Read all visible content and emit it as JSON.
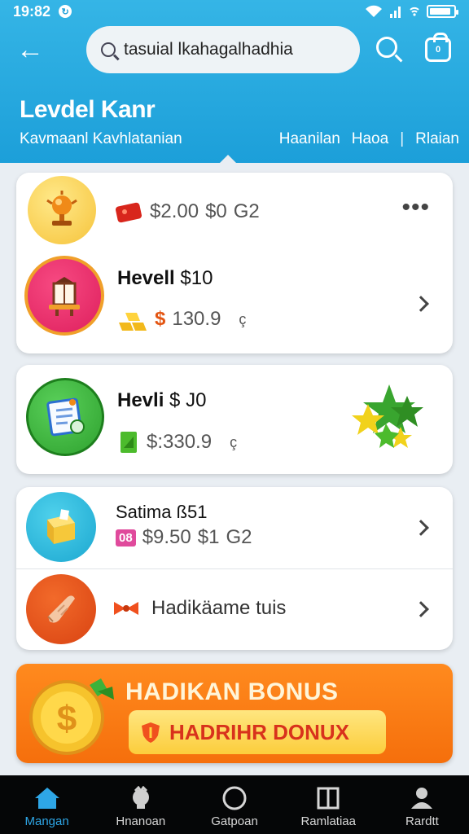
{
  "status": {
    "time": "19:82",
    "sync_icon": "sync-icon",
    "battery_level": 0.9
  },
  "header": {
    "back_icon": "arrow-left-icon",
    "search_value": "tasuial lkahagalhadhia",
    "search_icon": "search-icon",
    "bag_count": "0",
    "title": "Levdel Kanr",
    "subnav_left": "Kavmaanl Kavhlatanian",
    "tabs": [
      "Haanilan",
      "Haoa",
      "Rlaian"
    ],
    "tab_separator": "|",
    "accent": "#1c9fd9"
  },
  "card1": {
    "row1": {
      "amount": "$2.00",
      "extra": "$0",
      "code": "G2",
      "more_icon": "more-horizontal-icon"
    },
    "row2": {
      "title": "Hevell",
      "title_amount": "$10",
      "currency": "$",
      "amount": "130.9",
      "mark": "ç"
    }
  },
  "card2": {
    "title": "Hevli",
    "title_suffix": "$ J0",
    "amount": "$:330.9",
    "mark": "ç"
  },
  "card3": {
    "row1": {
      "title": "Satima",
      "title_suffix": "ß51",
      "badge": "08",
      "amount": "$9.50",
      "extra": "$1",
      "code": "G2"
    },
    "row2": {
      "label": "Hadikäame tuis"
    }
  },
  "bonus": {
    "title": "HADIKAN BONUS",
    "button_label": "HADRIHR DONUX"
  },
  "bottom_nav": [
    {
      "label": "Mangan",
      "icon": "home-icon",
      "active": true
    },
    {
      "label": "Hnanoan",
      "icon": "badge-icon",
      "active": false
    },
    {
      "label": "Gatpoan",
      "icon": "circle-icon",
      "active": false
    },
    {
      "label": "Ramlatiaa",
      "icon": "book-icon",
      "active": false
    },
    {
      "label": "Rardtt",
      "icon": "user-icon",
      "active": false
    }
  ]
}
